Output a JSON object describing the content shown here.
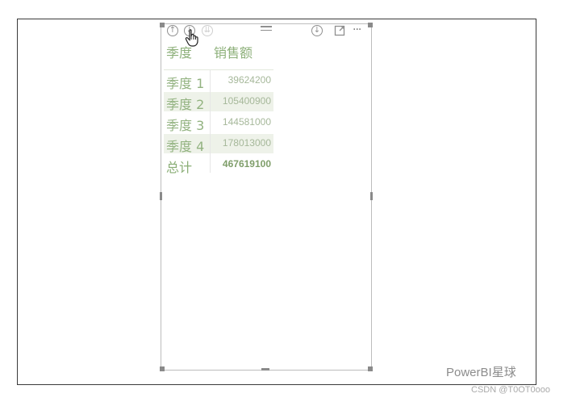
{
  "table": {
    "headers": [
      "季度",
      "销售额"
    ],
    "rows": [
      {
        "category": "季度 1",
        "value": "39624200"
      },
      {
        "category": "季度 2",
        "value": "105400900"
      },
      {
        "category": "季度 3",
        "value": "144581000"
      },
      {
        "category": "季度 4",
        "value": "178013000"
      }
    ],
    "total": {
      "label": "总计",
      "value": "467619100"
    }
  },
  "toolbar": {
    "icons": [
      "drill-up-icon",
      "drill-down-icon",
      "expand-all-icon",
      "drag-grip-icon",
      "download-icon",
      "focus-mode-icon",
      "more-options-icon"
    ],
    "more_glyph": "···"
  },
  "watermark": "PowerBI星球",
  "credit": "CSDN @T0OT0ooo",
  "colors": {
    "header_text": "#8db07a",
    "category_text": "#93b381",
    "value_text": "#a6b89a",
    "band": "#eef2e9"
  }
}
